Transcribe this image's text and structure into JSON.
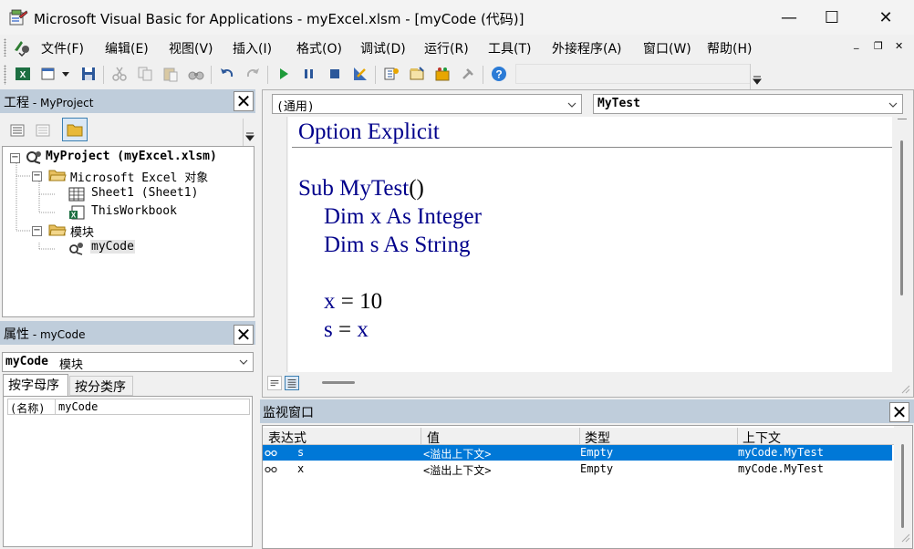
{
  "window": {
    "title": "Microsoft Visual Basic for Applications - myExcel.xlsm - [myCode (代码)]",
    "minimize": "—",
    "maximize": "☐",
    "close": "✕"
  },
  "menu": {
    "items": [
      "文件(F)",
      "编辑(E)",
      "视图(V)",
      "插入(I)",
      "格式(O)",
      "调试(D)",
      "运行(R)",
      "工具(T)",
      "外接程序(A)",
      "窗口(W)",
      "帮助(H)"
    ],
    "mdi_min": "_",
    "mdi_restore": "❐",
    "mdi_close": "✕"
  },
  "project": {
    "header_main": "工程",
    "header_sub": " - MyProject",
    "root": "MyProject (myExcel.xlsm)",
    "excel_objects": "Microsoft Excel 对象",
    "sheet1": "Sheet1 (Sheet1)",
    "thisworkbook": "ThisWorkbook",
    "modules": "模块",
    "mycode": "myCode",
    "close": "✕"
  },
  "properties": {
    "header_main": "属性",
    "header_sub": " - myCode",
    "object_name": "myCode",
    "object_type": " 模块",
    "tab_alpha": "按字母序",
    "tab_category": "按分类序",
    "prop_name": "(名称)",
    "prop_value": "myCode",
    "close": "✕"
  },
  "code": {
    "object_dropdown": "(通用)",
    "proc_dropdown": "MyTest",
    "line1_kw": "Option Explicit",
    "line2_kw1": "Sub ",
    "line2_rest": "MyTest",
    "line2_paren": "()",
    "line3_kw": "Dim x As Integer",
    "line4_kw": "Dim s As String",
    "line5_kw": "x",
    "line5_rest": " = 10",
    "line6_kw": "s",
    "line6_eq": " = ",
    "line6_kw2": "x"
  },
  "watch": {
    "title": "监视窗口",
    "columns": [
      "表达式",
      "值",
      "类型",
      "上下文"
    ],
    "rows": [
      {
        "expr": "s",
        "value": "<溢出上下文>",
        "type": "Empty",
        "context": "myCode.MyTest",
        "selected": true
      },
      {
        "expr": "x",
        "value": "<溢出上下文>",
        "type": "Empty",
        "context": "myCode.MyTest",
        "selected": false
      }
    ],
    "close": "✕"
  },
  "colors": {
    "accent_selection": "#0078d7",
    "code_keyword": "#00008b",
    "panel_header": "#bfcddb"
  }
}
